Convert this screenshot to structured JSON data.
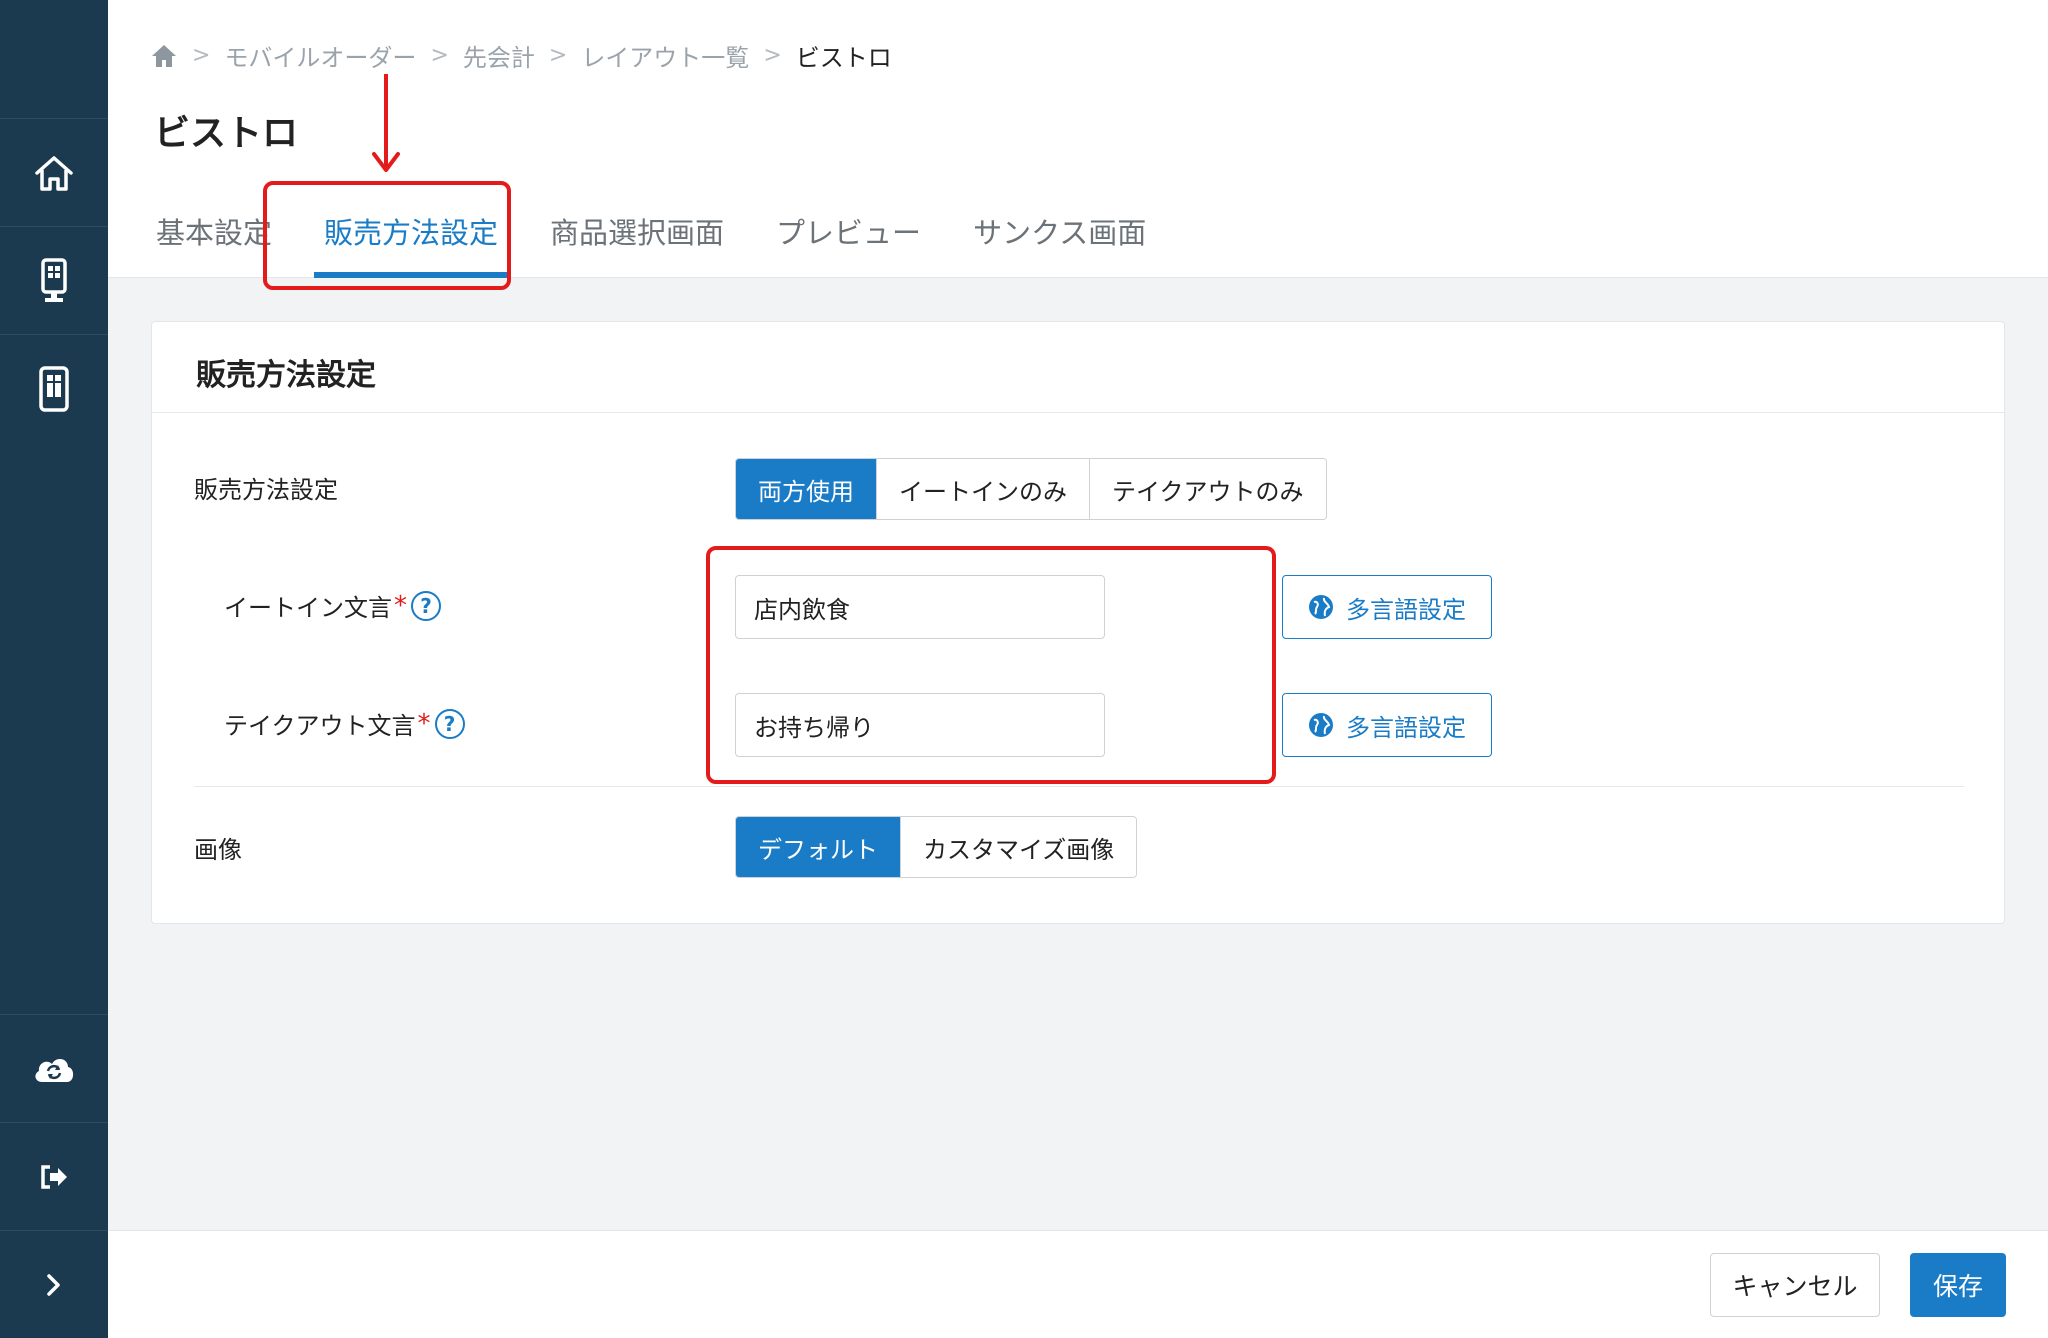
{
  "breadcrumb": {
    "items": [
      "モバイルオーダー",
      "先会計",
      "レイアウト一覧"
    ],
    "current": "ビストロ"
  },
  "page_title": "ビストロ",
  "tabs": [
    {
      "label": "基本設定"
    },
    {
      "label": "販売方法設定"
    },
    {
      "label": "商品選択画面"
    },
    {
      "label": "プレビュー"
    },
    {
      "label": "サンクス画面"
    }
  ],
  "card": {
    "title": "販売方法設定",
    "sales_method": {
      "label": "販売方法設定",
      "options": [
        "両方使用",
        "イートインのみ",
        "テイクアウトのみ"
      ],
      "selected": "両方使用"
    },
    "eatin": {
      "label": "イートイン文言",
      "required_mark": "*",
      "help": "?",
      "value": "店内飲食",
      "lang_button": "多言語設定"
    },
    "takeout": {
      "label": "テイクアウト文言",
      "required_mark": "*",
      "help": "?",
      "value": "お持ち帰り",
      "lang_button": "多言語設定"
    },
    "image": {
      "label": "画像",
      "options": [
        "デフォルト",
        "カスタマイズ画像"
      ],
      "selected": "デフォルト"
    }
  },
  "footer": {
    "cancel": "キャンセル",
    "save": "保存"
  },
  "sidebar": {
    "items": [
      "home-icon",
      "kiosk-icon",
      "tablet-icon",
      "cloud-sync-icon",
      "logout-icon",
      "expand-icon"
    ]
  },
  "colors": {
    "sidebar_bg": "#1b3a4f",
    "accent": "#1a7cc7",
    "highlight": "#e31b1b"
  }
}
